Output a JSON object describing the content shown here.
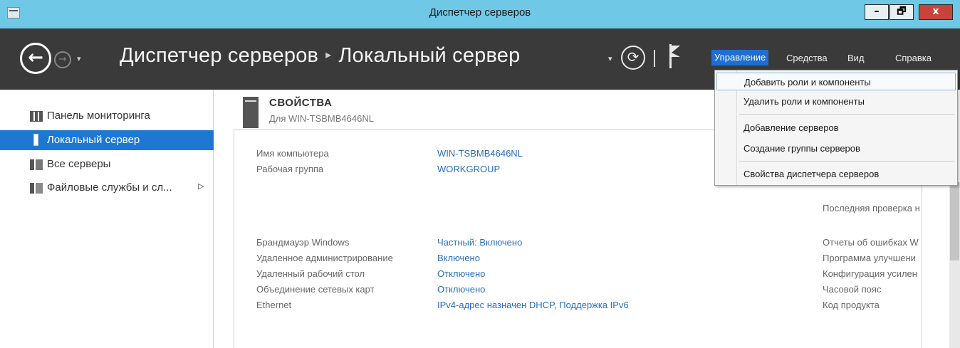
{
  "window": {
    "title": "Диспетчер серверов",
    "minimize": "–",
    "maximize": "🗗",
    "close": "x"
  },
  "header": {
    "back_icon": "←",
    "forward_icon": "→",
    "dropdown_icon": "▾",
    "breadcrumb_root": "Диспетчер серверов",
    "breadcrumb_sep": "▸",
    "breadcrumb_current": "Локальный сервер",
    "refresh_icon": "⟳",
    "menus": [
      "Управление",
      "Средства",
      "Вид",
      "Справка"
    ]
  },
  "sidebar": {
    "items": [
      {
        "label": "Панель мониторинга",
        "icon": "dashboard-icon",
        "active": false
      },
      {
        "label": "Локальный сервер",
        "icon": "local-server-icon",
        "active": true
      },
      {
        "label": "Все серверы",
        "icon": "all-servers-icon",
        "active": false
      },
      {
        "label": "Файловые службы и сл...",
        "icon": "file-services-icon",
        "active": false,
        "arrow": "▷"
      }
    ]
  },
  "properties": {
    "title": "СВОЙСТВА",
    "subtitle": "Для WIN-TSBMB4646NL",
    "rows_top": [
      {
        "key": "Имя компьютера",
        "value": "WIN-TSBMB4646NL"
      },
      {
        "key": "Рабочая группа",
        "value": "WORKGROUP"
      }
    ],
    "rows_bottom": [
      {
        "key": "Брандмауэр Windows",
        "value": "Частный: Включено"
      },
      {
        "key": "Удаленное администрирование",
        "value": "Включено"
      },
      {
        "key": "Удаленный рабочий стол",
        "value": "Отключено"
      },
      {
        "key": "Объединение сетевых карт",
        "value": "Отключено"
      },
      {
        "key": "Ethernet",
        "value": "IPv4-адрес назначен DHCP, Поддержка IPv6"
      }
    ],
    "right_col": [
      "Последняя проверка н",
      "Отчеты об ошибках W",
      "Программа улучшени",
      "Конфигурация усилен",
      "Часовой пояс",
      "Код продукта"
    ]
  },
  "manage_menu": {
    "items": [
      "Добавить роли и компоненты",
      "Удалить роли и компоненты",
      "Добавление серверов",
      "Создание группы серверов",
      "Свойства диспетчера серверов"
    ]
  },
  "colors": {
    "titlebar": "#6fc8e6",
    "header": "#3a3a3a",
    "accent": "#1e78d2",
    "link": "#2a6ebb"
  }
}
